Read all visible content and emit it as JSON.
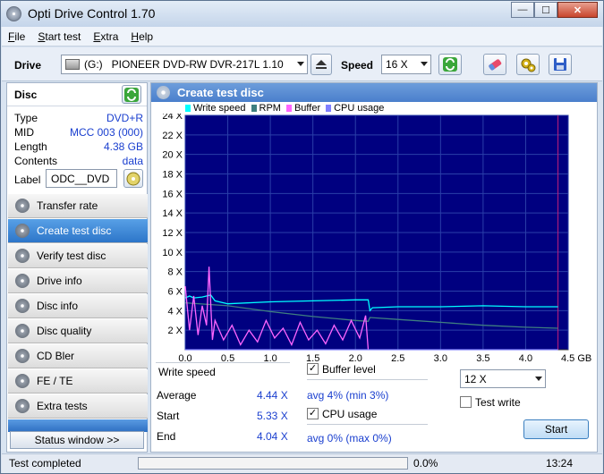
{
  "window": {
    "title": "Opti Drive Control 1.70",
    "minimize": "—",
    "maximize": "☐",
    "close": "✕"
  },
  "menu": [
    {
      "label": "File",
      "accel": "F",
      "rest": "ile"
    },
    {
      "label": "Start test",
      "accel": "S",
      "rest": "tart test"
    },
    {
      "label": "Extra",
      "accel": "E",
      "rest": "xtra"
    },
    {
      "label": "Help",
      "accel": "H",
      "rest": "elp"
    }
  ],
  "toolbar": {
    "drive_label": "Drive",
    "drive_letter": "(G:)",
    "drive_value": "PIONEER DVD-RW  DVR-217L 1.10",
    "speed_label": "Speed",
    "speed_value": "16 X",
    "icons": [
      "eject-icon",
      "refresh-icon",
      "eraser-icon",
      "settings-icon",
      "save-icon"
    ]
  },
  "disc": {
    "heading": "Disc",
    "rows": [
      {
        "key": "Type",
        "value": "DVD+R"
      },
      {
        "key": "MID",
        "value": "MCC 003 (000)"
      },
      {
        "key": "Length",
        "value": "4.38 GB"
      },
      {
        "key": "Contents",
        "value": "data"
      }
    ],
    "label_key": "Label",
    "label_value": "ODC__DVD"
  },
  "nav": [
    {
      "label": "Transfer rate",
      "active": false
    },
    {
      "label": "Create test disc",
      "active": true
    },
    {
      "label": "Verify test disc",
      "active": false
    },
    {
      "label": "Drive info",
      "active": false
    },
    {
      "label": "Disc info",
      "active": false
    },
    {
      "label": "Disc quality",
      "active": false
    },
    {
      "label": "CD Bler",
      "active": false
    },
    {
      "label": "FE / TE",
      "active": false
    },
    {
      "label": "Extra tests",
      "active": false
    }
  ],
  "status_window_button": "Status window >>",
  "panel": {
    "title": "Create test disc",
    "legend": [
      {
        "name": "Write speed",
        "color": "#00ffff"
      },
      {
        "name": "RPM",
        "color": "#3f7f7f"
      },
      {
        "name": "Buffer",
        "color": "#ff66ff"
      },
      {
        "name": "CPU usage",
        "color": "#8080ff"
      }
    ]
  },
  "chart_data": {
    "type": "line",
    "xunit": "GB",
    "xlim": [
      0,
      4.5
    ],
    "ylim": [
      0,
      24
    ],
    "x_ticks": [
      "0.0",
      "0.5",
      "1.0",
      "1.5",
      "2.0",
      "2.5",
      "3.0",
      "3.5",
      "4.0",
      "4.5 GB"
    ],
    "y_ticks": [
      "2 X",
      "4 X",
      "6 X",
      "8 X",
      "10 X",
      "12 X",
      "14 X",
      "16 X",
      "18 X",
      "20 X",
      "22 X",
      "24 X"
    ],
    "grid": true,
    "background": "#000080",
    "disc_end": 4.38,
    "series": [
      {
        "name": "Write speed",
        "color": "#00ffff",
        "x": [
          0.0,
          0.05,
          0.1,
          0.2,
          0.3,
          0.35,
          0.5,
          1.0,
          1.5,
          2.0,
          2.15,
          2.17,
          2.2,
          2.5,
          3.0,
          3.5,
          4.0,
          4.38
        ],
        "y": [
          5.3,
          5.5,
          5.3,
          5.4,
          5.6,
          5.0,
          4.7,
          4.9,
          5.0,
          5.1,
          5.1,
          4.0,
          4.3,
          4.4,
          4.4,
          4.5,
          4.4,
          4.4
        ]
      },
      {
        "name": "RPM",
        "color": "#3f7f7f",
        "x": [
          0.0,
          0.5,
          1.0,
          1.5,
          2.0,
          2.15,
          2.17,
          2.5,
          3.0,
          3.5,
          4.0,
          4.38
        ],
        "y": [
          4.8,
          4.5,
          3.9,
          3.4,
          3.0,
          2.9,
          3.3,
          3.1,
          2.8,
          2.5,
          2.3,
          2.2
        ]
      },
      {
        "name": "Buffer",
        "color": "#ff66ff",
        "x": [
          0.0,
          0.05,
          0.1,
          0.15,
          0.2,
          0.25,
          0.28,
          0.32,
          0.35,
          0.45,
          0.55,
          0.65,
          0.75,
          0.85,
          0.95,
          1.05,
          1.15,
          1.25,
          1.35,
          1.45,
          1.55,
          1.65,
          1.75,
          1.85,
          1.95,
          2.05,
          2.12,
          2.15
        ],
        "y": [
          6.5,
          2.0,
          5.5,
          1.5,
          4.5,
          2.5,
          8.5,
          1.0,
          3.0,
          1.0,
          2.5,
          0.5,
          2.0,
          0.8,
          3.0,
          1.2,
          2.2,
          0.5,
          2.8,
          1.0,
          2.0,
          0.6,
          2.5,
          1.0,
          3.0,
          1.2,
          3.5,
          0.0
        ]
      },
      {
        "name": "CPU usage",
        "color": "#8080ff",
        "x": [
          0.0,
          4.38
        ],
        "y": [
          0.0,
          0.0
        ]
      }
    ]
  },
  "stats": {
    "write_speed_label": "Write speed",
    "average_label": "Average",
    "average_value": "4.44 X",
    "start_label": "Start",
    "start_value": "5.33 X",
    "end_label": "End",
    "end_value": "4.04 X",
    "buffer_level_label": "Buffer level",
    "buffer_level_checked": true,
    "buffer_level_value": "avg 4% (min 3%)",
    "cpu_usage_label": "CPU usage",
    "cpu_usage_checked": true,
    "cpu_usage_value": "avg 0% (max 0%)",
    "write_speed_select": "12 X",
    "test_write_label": "Test write",
    "test_write_checked": false,
    "start_button": "Start",
    "checkmark": "✓"
  },
  "statusbar": {
    "text": "Test completed",
    "progress_percent": 0.0,
    "progress_text": "0.0%",
    "time": "13:24"
  }
}
